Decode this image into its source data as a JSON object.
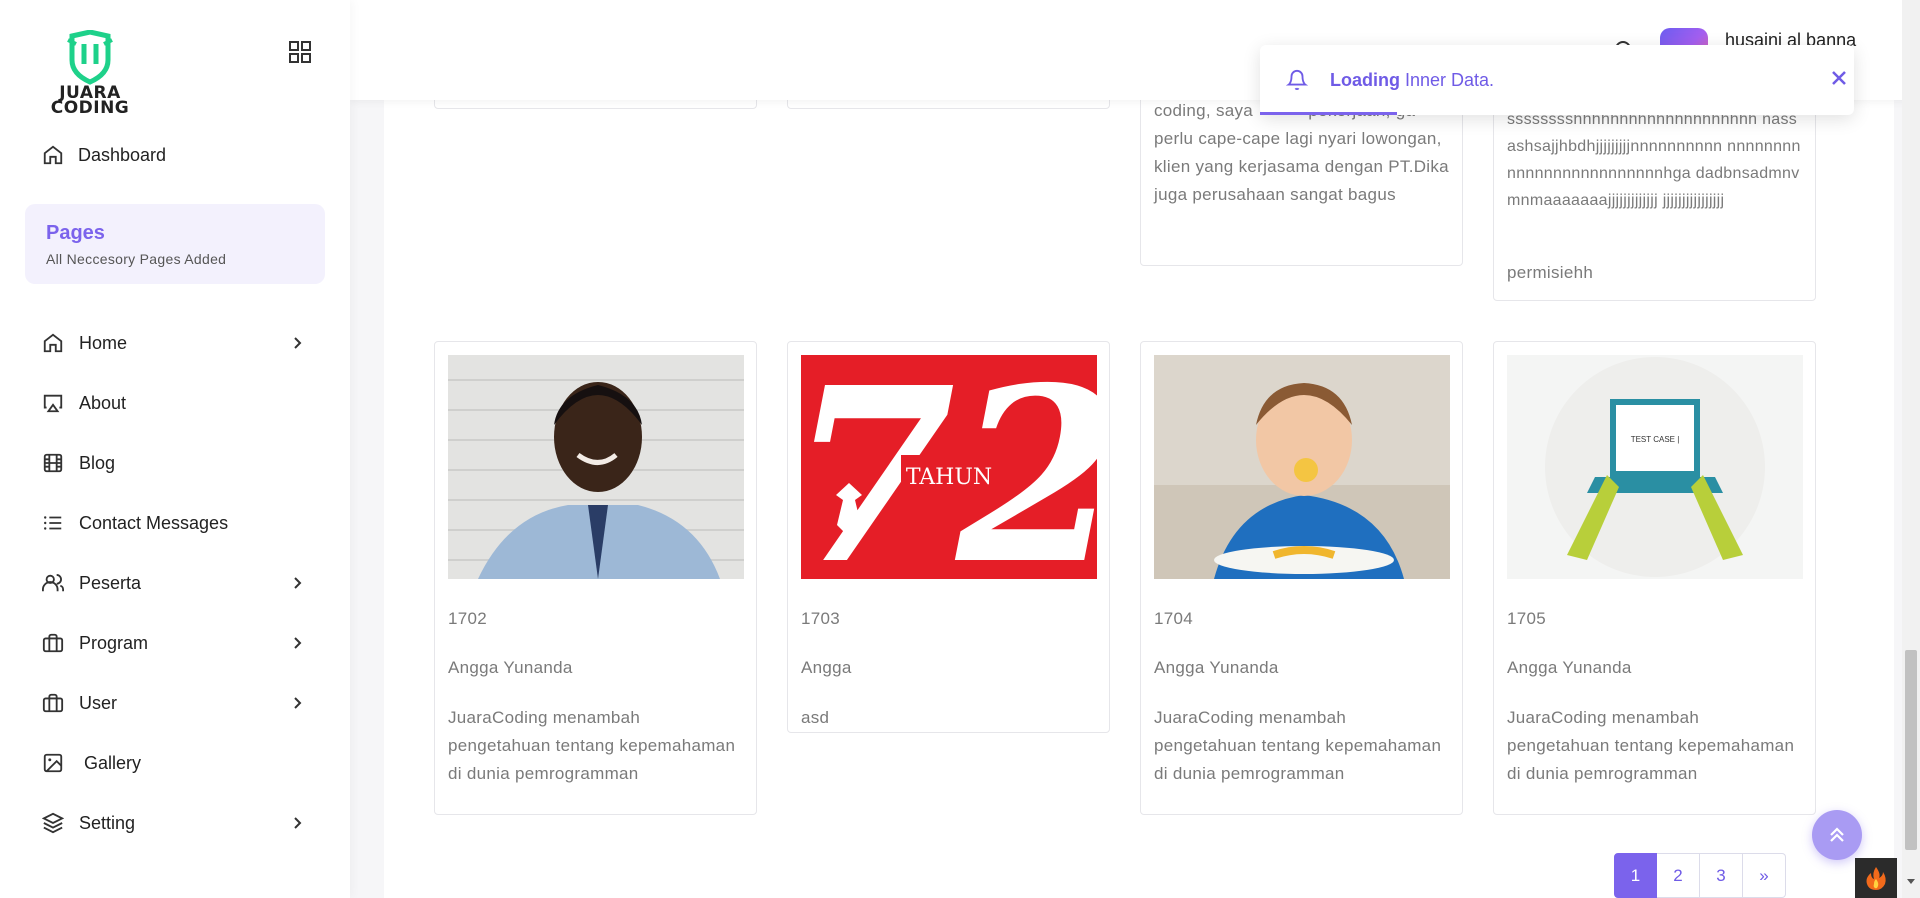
{
  "sidebar": {
    "logo_text_line1": "JUARA",
    "logo_text_line2": "CODING",
    "dashboard_label": "Dashboard",
    "pages_title": "Pages",
    "pages_subtitle": "All Neccesory Pages Added",
    "items": [
      {
        "label": "Home",
        "icon": "home-icon",
        "has_submenu": true
      },
      {
        "label": "About",
        "icon": "airplay-icon",
        "has_submenu": false
      },
      {
        "label": "Blog",
        "icon": "film-icon",
        "has_submenu": false
      },
      {
        "label": "Contact Messages",
        "icon": "list-icon",
        "has_submenu": false
      },
      {
        "label": "Peserta",
        "icon": "users-icon",
        "has_submenu": true
      },
      {
        "label": "Program",
        "icon": "briefcase-icon",
        "has_submenu": true
      },
      {
        "label": "User",
        "icon": "briefcase-icon",
        "has_submenu": true
      },
      {
        "label": "Gallery",
        "icon": "image-icon",
        "has_submenu": false
      },
      {
        "label": "Setting",
        "icon": "layers-icon",
        "has_submenu": true
      }
    ]
  },
  "header": {
    "username": "husaini al banna"
  },
  "toast": {
    "strong": "Loading",
    "message": " Inner Data.",
    "progress": 0.23
  },
  "top_cards": {
    "card3_text": "coding, saya           pekerjaan, ga perlu cape-cape lagi nyari lowongan, klien yang kerjasama dengan PT.Dika juga perusahaan sangat bagus",
    "card4_text": "sssssssshhhhhhhhhhhhhhhhhhhh nassashsajjhbdhjjjjjjjjjnnnnnnnnnn nnnnnnnnnnnnnnnnnnnnnnnnnhga dadbnsadmnvmnmaaaaaaajjjjjjjjjjjjj jjjjjjjjjjjjjjjj",
    "card4_name": "permisiehh"
  },
  "cards": [
    {
      "id": "1702",
      "name": "Angga Yunanda",
      "desc": "JuaraCoding menambah pengetahuan tentang kepemahaman di dunia pemrogramman"
    },
    {
      "id": "1703",
      "name": "Angga",
      "desc": "asd",
      "image_text": "TAHUN",
      "image_number": "72"
    },
    {
      "id": "1704",
      "name": "Angga Yunanda",
      "desc": "JuaraCoding menambah pengetahuan tentang kepemahaman di dunia pemrogramman"
    },
    {
      "id": "1705",
      "name": "Angga Yunanda",
      "desc": "JuaraCoding menambah pengetahuan tentang kepemahaman di dunia pemrogramman",
      "image_text": "TEST CASE |"
    }
  ],
  "pagination": {
    "pages": [
      "1",
      "2",
      "3",
      "»"
    ],
    "active": "1"
  },
  "colors": {
    "accent": "#7b63ec",
    "card_border": "#e6e6ea",
    "text_muted": "#7a7a7a"
  }
}
